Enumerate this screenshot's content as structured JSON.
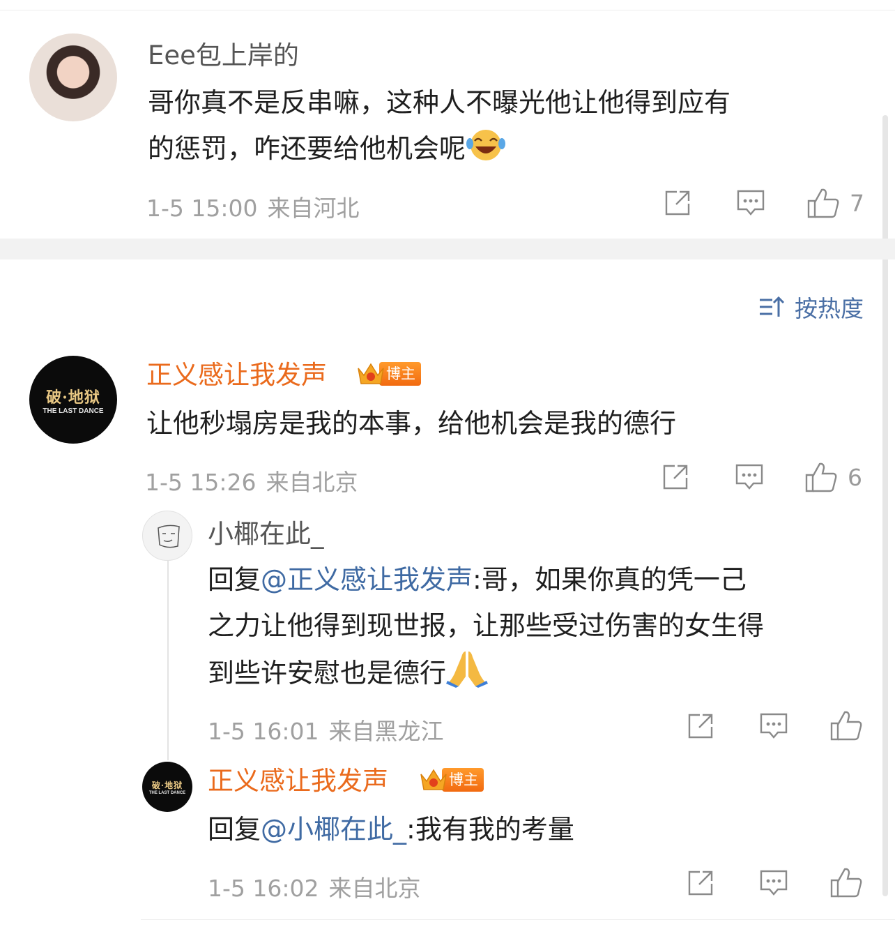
{
  "comments": [
    {
      "username": "Eee包上岸的",
      "text_lines": [
        "哥你真不是反串嘛，这种人不曝光他让他得到应有",
        "的惩罚，咋还要给他机会呢"
      ],
      "emoji": "laughing-tears",
      "time": "1-5 15:00",
      "location": "来自河北",
      "likes": "7"
    },
    {
      "username": "正义感让我发声",
      "badge": "博主",
      "avatar_text": "破·地狱",
      "avatar_subtext": "THE LAST DANCE",
      "text": "让他秒塌房是我的本事，给他机会是我的德行",
      "time": "1-5 15:26",
      "location": "来自北京",
      "likes": "6",
      "replies": [
        {
          "username": "小椰在此_",
          "reply_prefix": "回复",
          "mention": "@正义感让我发声",
          "text_line1": ":哥，如果你真的凭一己",
          "text_line2": "之力让他得到现世报，让那些受过伤害的女生得",
          "text_line3": "到些许安慰也是德行",
          "emoji": "folded-hands",
          "time": "1-5 16:01",
          "location": "来自黑龙江"
        },
        {
          "username": "正义感让我发声",
          "badge": "博主",
          "avatar_text": "破·地狱",
          "avatar_subtext": "THE LAST DANCE",
          "reply_prefix": "回复",
          "mention": "@小椰在此_",
          "text": ":我有我的考量",
          "time": "1-5 16:02",
          "location": "来自北京"
        }
      ]
    }
  ],
  "sort": {
    "label": "按热度"
  },
  "colors": {
    "accent_orange": "#ea6a1c",
    "link_blue": "#3f6aa3",
    "meta_gray": "#a0a0a0"
  },
  "icons": [
    "share-icon",
    "comment-icon",
    "like-icon",
    "sort-icon",
    "crown-icon"
  ]
}
